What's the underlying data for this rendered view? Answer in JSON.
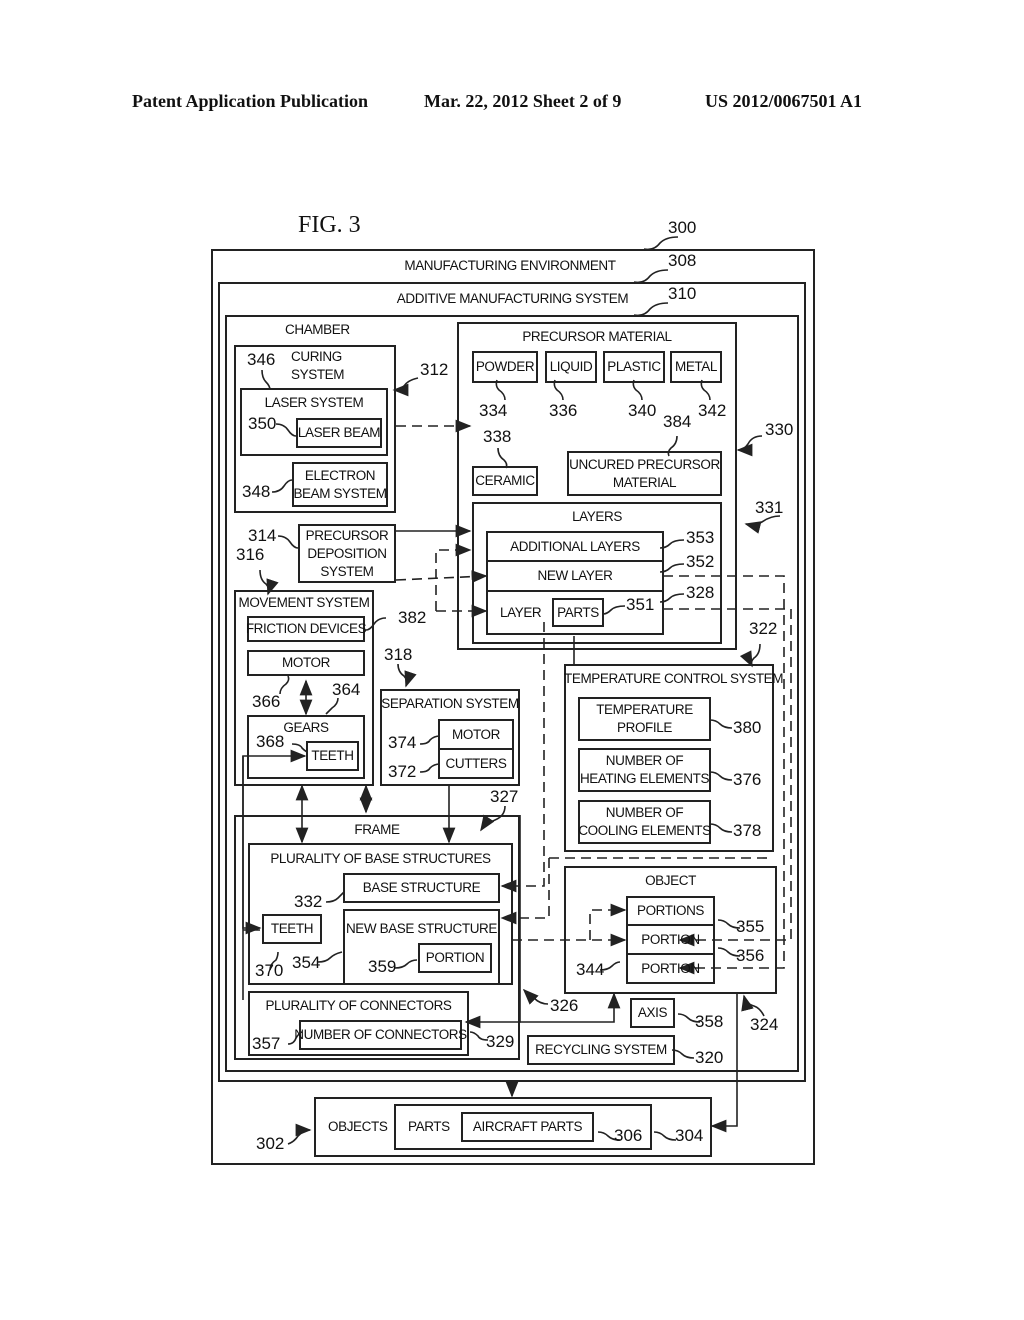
{
  "header": {
    "publication": "Patent Application Publication",
    "date_sheet": "Mar. 22, 2012  Sheet 2 of 9",
    "pub_number": "US 2012/0067501 A1"
  },
  "figure": {
    "title": "FIG. 3"
  },
  "blocks": {
    "manufacturing_environment": {
      "label": "MANUFACTURING ENVIRONMENT",
      "ref": "300"
    },
    "additive_manufacturing_system": {
      "label": "ADDITIVE MANUFACTURING SYSTEM",
      "ref": "308"
    },
    "chamber": {
      "label": "CHAMBER",
      "ref": "310"
    },
    "curing_system": {
      "label_line1": "CURING",
      "label_line2": "SYSTEM",
      "ref": "346"
    },
    "laser_system": {
      "label": "LASER SYSTEM",
      "ref": "312"
    },
    "laser_beam": {
      "label": "LASER BEAM",
      "ref": "350"
    },
    "electron_beam_system": {
      "label_line1": "ELECTRON",
      "label_line2": "BEAM SYSTEM",
      "ref": "348"
    },
    "precursor_deposition_system": {
      "label_line1": "PRECURSOR",
      "label_line2": "DEPOSITION",
      "label_line3": "SYSTEM",
      "ref": "314"
    },
    "movement_system": {
      "label": "MOVEMENT SYSTEM",
      "ref": "316"
    },
    "friction_devices": {
      "label": "FRICTION DEVICES",
      "ref": "382"
    },
    "motor_movement": {
      "label": "MOTOR",
      "ref": "366"
    },
    "gears": {
      "label": "GEARS",
      "ref": "364"
    },
    "teeth_gears": {
      "label": "TEETH",
      "ref": "368"
    },
    "separation_system": {
      "label": "SEPARATION SYSTEM",
      "ref": "318"
    },
    "motor_separation": {
      "label": "MOTOR",
      "ref": "374"
    },
    "cutters": {
      "label": "CUTTERS",
      "ref": "372"
    },
    "precursor_material": {
      "label": "PRECURSOR MATERIAL",
      "ref": "330"
    },
    "powder": {
      "label": "POWDER",
      "ref": "334"
    },
    "liquid": {
      "label": "LIQUID",
      "ref": "336"
    },
    "plastic": {
      "label": "PLASTIC",
      "ref": "340"
    },
    "metal": {
      "label": "METAL",
      "ref": "342"
    },
    "ceramic": {
      "label": "CERAMIC",
      "ref": "338"
    },
    "uncured_precursor_material": {
      "label_line1": "UNCURED PRECURSOR",
      "label_line2": "MATERIAL",
      "ref": "384"
    },
    "layers": {
      "label": "LAYERS",
      "ref": "331"
    },
    "additional_layers": {
      "label": "ADDITIONAL LAYERS",
      "ref": "353"
    },
    "new_layer": {
      "label": "NEW LAYER",
      "ref": "352"
    },
    "layer": {
      "label": "LAYER",
      "ref": "328"
    },
    "parts_layer": {
      "label": "PARTS",
      "ref": "351"
    },
    "temperature_control_system": {
      "label": "TEMPERATURE CONTROL SYSTEM",
      "ref": "322"
    },
    "temperature_profile": {
      "label_line1": "TEMPERATURE",
      "label_line2": "PROFILE",
      "ref": "380"
    },
    "heating_elements": {
      "label_line1": "NUMBER OF",
      "label_line2": "HEATING ELEMENTS",
      "ref": "376"
    },
    "cooling_elements": {
      "label_line1": "NUMBER OF",
      "label_line2": "COOLING ELEMENTS",
      "ref": "378"
    },
    "frame": {
      "label": "FRAME",
      "ref": "326"
    },
    "plurality_base_structures": {
      "label": "PLURALITY OF BASE STRUCTURES",
      "ref": "327"
    },
    "base_structure": {
      "label": "BASE STRUCTURE",
      "ref": "332"
    },
    "new_base_structure": {
      "label": "NEW BASE STRUCTURE",
      "ref": "354"
    },
    "portion_base": {
      "label": "PORTION",
      "ref": "359"
    },
    "teeth_frame": {
      "label": "TEETH",
      "ref": "370"
    },
    "plurality_connectors": {
      "label": "PLURALITY OF CONNECTORS",
      "ref": "329"
    },
    "number_connectors": {
      "label": "NUMBER OF CONNECTORS",
      "ref": "357"
    },
    "object": {
      "label": "OBJECT",
      "ref": "324"
    },
    "portions": {
      "label": "PORTIONS",
      "ref": "355"
    },
    "portion_mid": {
      "label": "PORTION",
      "ref": "356"
    },
    "portion_bottom": {
      "label": "PORTION",
      "ref": "344"
    },
    "axis": {
      "label": "AXIS",
      "ref": "358"
    },
    "recycling_system": {
      "label": "RECYCLING SYSTEM",
      "ref": "320"
    },
    "objects": {
      "label": "OBJECTS",
      "ref": "302"
    },
    "parts": {
      "label": "PARTS",
      "ref": "304"
    },
    "aircraft_parts": {
      "label": "AIRCRAFT PARTS",
      "ref": "306"
    }
  }
}
